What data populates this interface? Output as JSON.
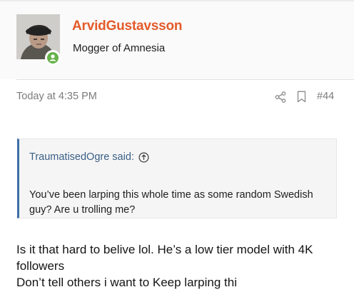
{
  "user": {
    "username": "ArvidGustavsson",
    "title": "Mogger of Amnesia"
  },
  "meta": {
    "timestamp": "Today at 4:35 PM",
    "post_number": "#44"
  },
  "icons": {
    "share": "share-icon",
    "bookmark": "bookmark-icon",
    "quote_jump": "arrow-up-circle-icon",
    "online": "online-status-icon"
  },
  "quote": {
    "attribution": "TraumatisedOgre said:",
    "text": "You’ve been larping this whole time as some random Swedish guy? Are u trolling me?"
  },
  "post": {
    "line1": "Is it that hard to belive lol. He’s a low tier model with 4K followers",
    "line2": "Don’t tell others i want to Keep larping thi"
  },
  "colors": {
    "username": "#e45a2a",
    "quote_border": "#3d6fa8",
    "online_badge": "#67b24b",
    "meta_text": "#7b7b7b"
  }
}
